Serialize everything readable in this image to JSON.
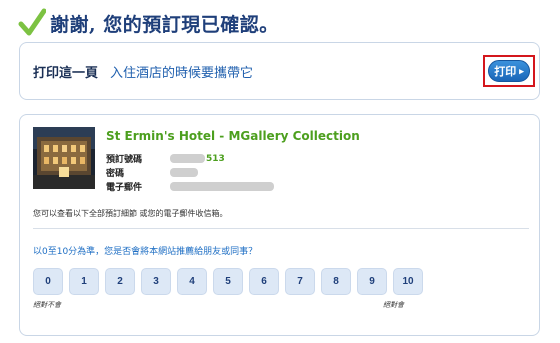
{
  "header": {
    "title": "謝謝, 您的預訂現已確認。"
  },
  "print_card": {
    "label": "打印這一頁",
    "note": "入住酒店的時候要攜帶它",
    "button_label": "打印"
  },
  "hotel": {
    "name": "St Ermin's Hotel - MGallery Collection",
    "booking_number_label": "預訂號碼",
    "booking_number_visible_suffix": "513",
    "password_label": "密碼",
    "email_label": "電子郵件",
    "view_note": "您可以查看以下全部預訂細節 或您的電子郵件收信箱。"
  },
  "survey": {
    "question": "以0至10分為準，您是否會將本網站推薦給朋友或同事？",
    "scores": [
      "0",
      "1",
      "2",
      "3",
      "4",
      "5",
      "6",
      "7",
      "8",
      "9",
      "10"
    ],
    "low_label": "絕對不會",
    "high_label": "絕對會"
  },
  "colors": {
    "accent_green": "#4c9f1e",
    "link_blue": "#1f6fc4",
    "highlight_red": "#d4161c"
  }
}
